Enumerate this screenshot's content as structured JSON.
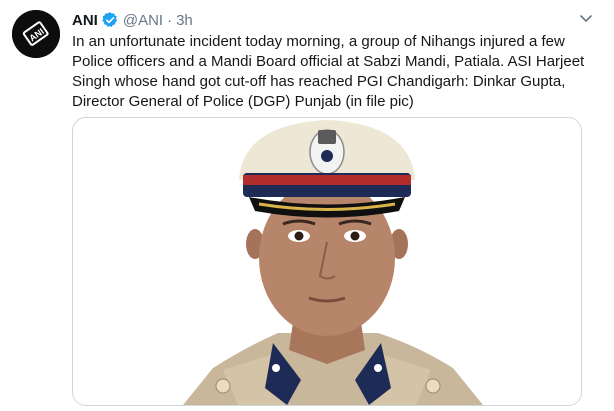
{
  "tweet": {
    "author_name": "ANI",
    "handle": "@ANI",
    "separator": "·",
    "time": "3h",
    "text": "In an unfortunate incident today morning, a group of Nihangs injured a few Police officers and a Mandi Board official at Sabzi Mandi, Patiala. ASI Harjeet Singh whose hand got cut-off has reached PGI Chandigarh: Dinkar Gupta, Director General of Police (DGP) Punjab (in file pic)",
    "avatar_logo": "ANI"
  },
  "icons": {
    "verified": "verified-badge-icon",
    "menu": "chevron-down-icon"
  },
  "colors": {
    "text": "#14171a",
    "secondary": "#657786",
    "verified": "#1da1f2",
    "border": "#ccd6dd",
    "cap": "#efe7d6",
    "cap_band": "#1e2b57",
    "cap_red": "#b32c2c",
    "uniform": "#c8b79a"
  }
}
